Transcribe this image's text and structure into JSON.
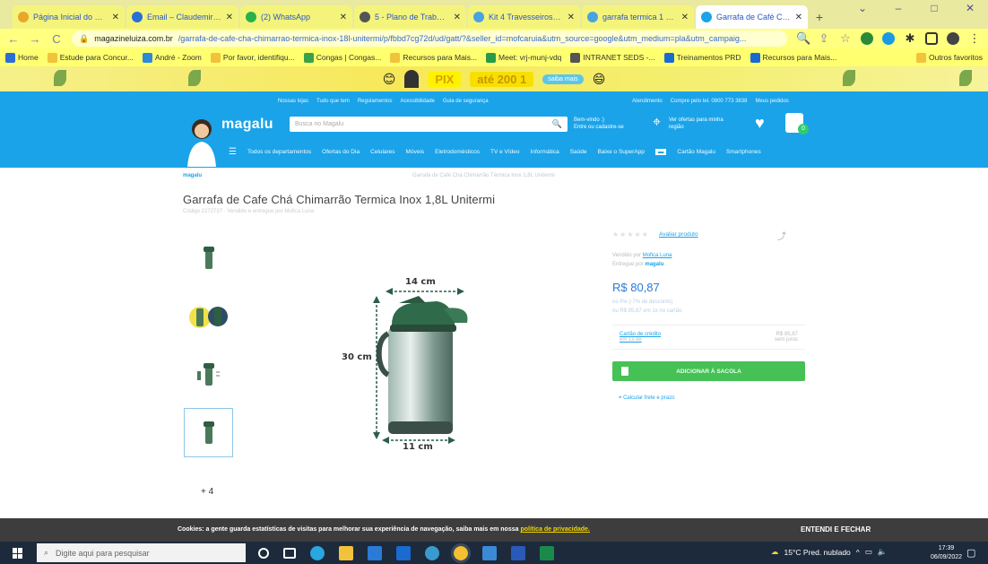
{
  "browser": {
    "tabs": [
      {
        "label": "Página Inicial do Micro",
        "color": "#e9a629"
      },
      {
        "label": "Email – Claudemir Luc",
        "color": "#2a6ed8"
      },
      {
        "label": "(2) WhatsApp",
        "color": "#2ab24a"
      },
      {
        "label": "5 - Plano de Trabalho -",
        "color": "#555555"
      },
      {
        "label": "Kit 4 Travesseiros Fazio",
        "color": "#4aa3e0"
      },
      {
        "label": "garrafa termica 1 8l ino",
        "color": "#4aa3e0"
      },
      {
        "label": "Garrafa de Café Chá C",
        "color": "#1aa3e8"
      }
    ],
    "new_tab": "+",
    "window_controls": [
      "⌄",
      "–",
      "□",
      "✕"
    ],
    "url_host": "magazineluiza.com.br",
    "url_path": "/garrafa-de-cafe-cha-chimarrao-termica-inox-18l-unitermi/p/fbbd7cg72d/ud/gatt/?&seller_id=mofcaruia&utm_source=google&utm_medium=pla&utm_campaig...",
    "bookmarks": [
      "Home",
      "Estude para Concur...",
      "André - Zoom",
      "Por favor, identifiqu...",
      "Congas | Congas...",
      "Recursos para Mais...",
      "Meet: vrj-munj-vdq",
      "INTRANET SEDS -...",
      "Treinamentos PRD",
      "Recursos para Mais...",
      "Outros favoritos"
    ]
  },
  "promo": {
    "tag": "PIX",
    "text": "até 200 1",
    "chip": "saiba mais"
  },
  "header": {
    "top_links": [
      "Nossas lojas",
      "Tudo que tem",
      "Regulamentos",
      "Acessibilidade",
      "Guia de segurança"
    ],
    "top_links_right": [
      "Atendimento",
      "Compre pelo tel. 0800 773 3838",
      "Meus pedidos"
    ],
    "logo": "magalu",
    "search_placeholder": "Busca no Magalu",
    "login_line1": "Bem-vindo :)",
    "login_line2": "Entre ou cadastre-se",
    "location_line1": "Ver ofertas para minha",
    "location_line2": "região",
    "cart_count": "0",
    "categories": [
      "Todos os departamentos",
      "Ofertas do Dia",
      "Celulares",
      "Móveis",
      "Eletrodomésticos",
      "TV e Vídeo",
      "Informática",
      "Saúde",
      "Baixe o SuperApp",
      "Cartão Magalu",
      "Smartphones"
    ]
  },
  "product": {
    "breadcrumb_logo": "magalu",
    "breadcrumb": "Garrafa de Café Chá Chimarrão Térmica Inox 1,8L Unitermi",
    "title": "Garrafa de Cafe Chá Chimarrão Termica Inox 1,8L Unitermi",
    "subtitle": "Código 2272737 · Vendido e entregue por Mofica Luna",
    "more_images": "+ 4",
    "dim_width": "14 cm",
    "dim_height": "30 cm",
    "dim_base": "11 cm",
    "stars": "★★★★★",
    "reviews_link": "Avaliar produto",
    "seller_label": "Vendido por",
    "seller_name": "Mofica Luna",
    "delivery_label": "Entregue por",
    "delivery_name": "magalu",
    "price": "R$ 80,87",
    "price_line1": "no Pix (-7% de desconto)",
    "price_line2": "ou R$ 85,87 em 1x no cartão",
    "card_label": "Cartão de crédito",
    "card_sub": "em 1x de",
    "card_value": "R$ 85,87",
    "card_value2": "sem juros",
    "add_button": "ADICIONAR À SACOLA",
    "freight": "Calcular frete e prazo"
  },
  "cookie": {
    "text_bold": "Cookies: a gente guarda estatísticas de visitas para melhorar sua experiência de navegação, saiba mais em nossa ",
    "link": "política de privacidade.",
    "button": "ENTENDI E FECHAR"
  },
  "taskbar": {
    "search_placeholder": "Digite aqui para pesquisar",
    "weather": "15°C  Pred. nublado",
    "time": "17:39",
    "date": "06/09/2022"
  }
}
